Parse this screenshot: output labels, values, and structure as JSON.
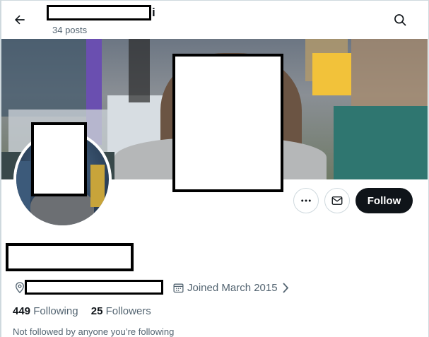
{
  "header": {
    "name_tail": "i",
    "posts_count": "34 posts",
    "back_icon": "arrow-left-icon",
    "search_icon": "search-icon"
  },
  "profile": {
    "location_icon": "location-pin-icon",
    "calendar_icon": "calendar-icon",
    "joined": "Joined March 2015",
    "following_count": "449",
    "following_label": "Following",
    "followers_count": "25",
    "followers_label": "Followers",
    "not_followed_text": "Not followed by anyone you’re following"
  },
  "actions": {
    "more_icon": "more-horizontal-icon",
    "message_icon": "envelope-icon",
    "follow_label": "Follow"
  },
  "colors": {
    "text_primary": "#0f1419",
    "text_secondary": "#536471",
    "border": "#cfd9de",
    "follow_bg": "#0f1419"
  }
}
